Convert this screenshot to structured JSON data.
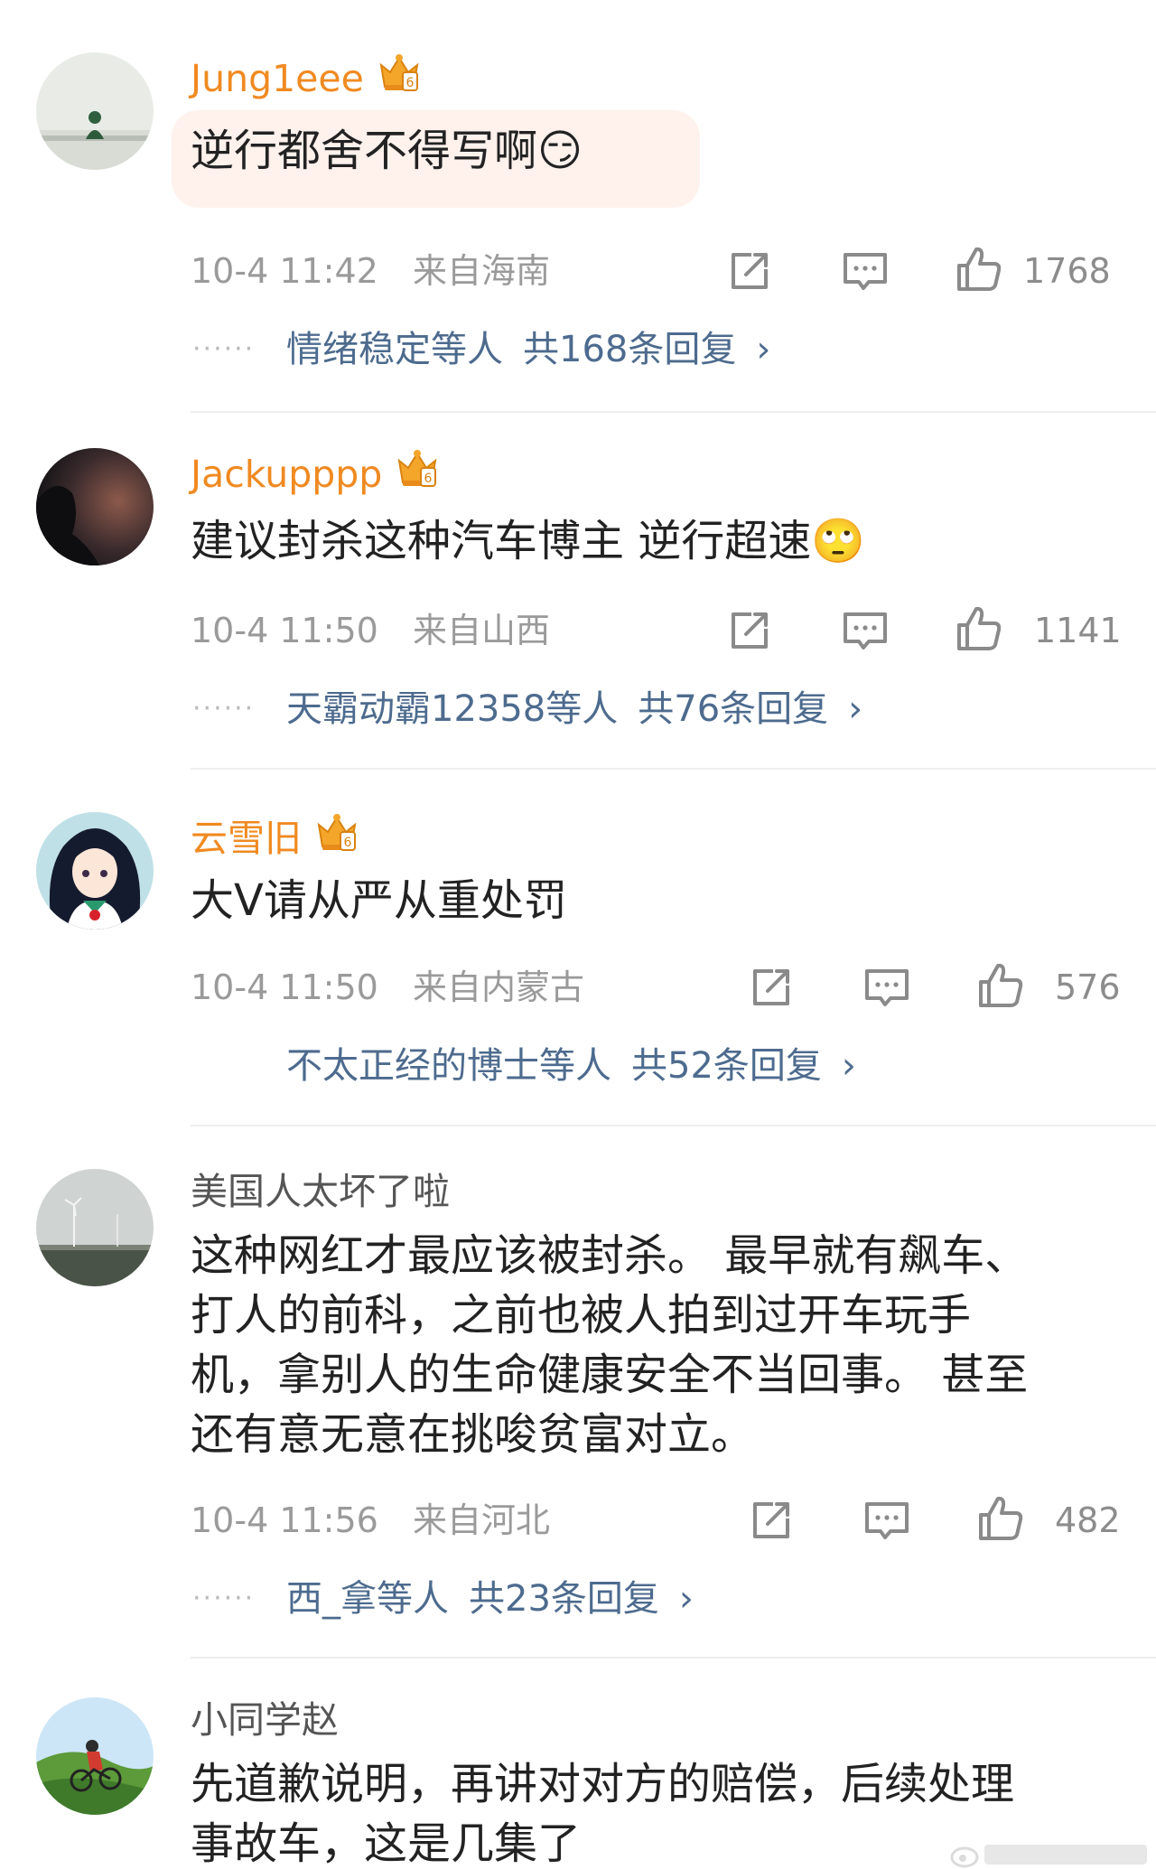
{
  "comments": [
    {
      "username": "Jung1eee",
      "text_lines": [
        "逆行都舍不得写啊😏"
      ],
      "time": "10-4 11:42",
      "location": "来自海南",
      "likes": "1768",
      "reply_names": "情绪稳定等人",
      "reply_count": "共168条回复",
      "chevron": "›"
    },
    {
      "username": "Jackupppp",
      "text_lines": [
        "建议封杀这种汽车博主 逆行超速🙄"
      ],
      "time": "10-4 11:50",
      "location": "来自山西",
      "likes": "1141",
      "reply_names": "天霸动霸12358等人",
      "reply_count": "共76条回复",
      "chevron": "›"
    },
    {
      "username": "云雪旧",
      "text_lines": [
        "大V请从严从重处罚"
      ],
      "time": "10-4 11:50",
      "location": "来自内蒙古",
      "likes": "576",
      "reply_names": "不太正经的博士等人",
      "reply_count": "共52条回复",
      "chevron": "›"
    },
    {
      "username": "美国人太坏了啦",
      "text_lines": [
        "这种网红才最应该被封杀。 最早就有飙车、",
        "打人的前科，之前也被人拍到过开车玩手",
        "机，拿别人的生命健康安全不当回事。 甚至",
        "还有意无意在挑唆贫富对立。"
      ],
      "time": "10-4 11:56",
      "location": "来自河北",
      "likes": "482",
      "reply_names": "西_拿等人",
      "reply_count": "共23条回复",
      "chevron": "›"
    },
    {
      "username": "小同学赵",
      "text_lines": [
        "先道歉说明，再讲对对方的赔偿，后续处理",
        "事故车，这是几集了"
      ]
    }
  ],
  "icons": {
    "vip_badge": "crown-badge-icon",
    "share": "share-icon",
    "comment": "comment-icon",
    "like": "thumbs-up-icon"
  },
  "colors": {
    "username_vip": "#f08a21",
    "username_plain": "#555555",
    "body_text": "#222222",
    "meta_text": "#9a9a9a",
    "reply_link": "#4d6b8e",
    "bubble": "#fff1ec",
    "divider": "#eeeeee"
  }
}
